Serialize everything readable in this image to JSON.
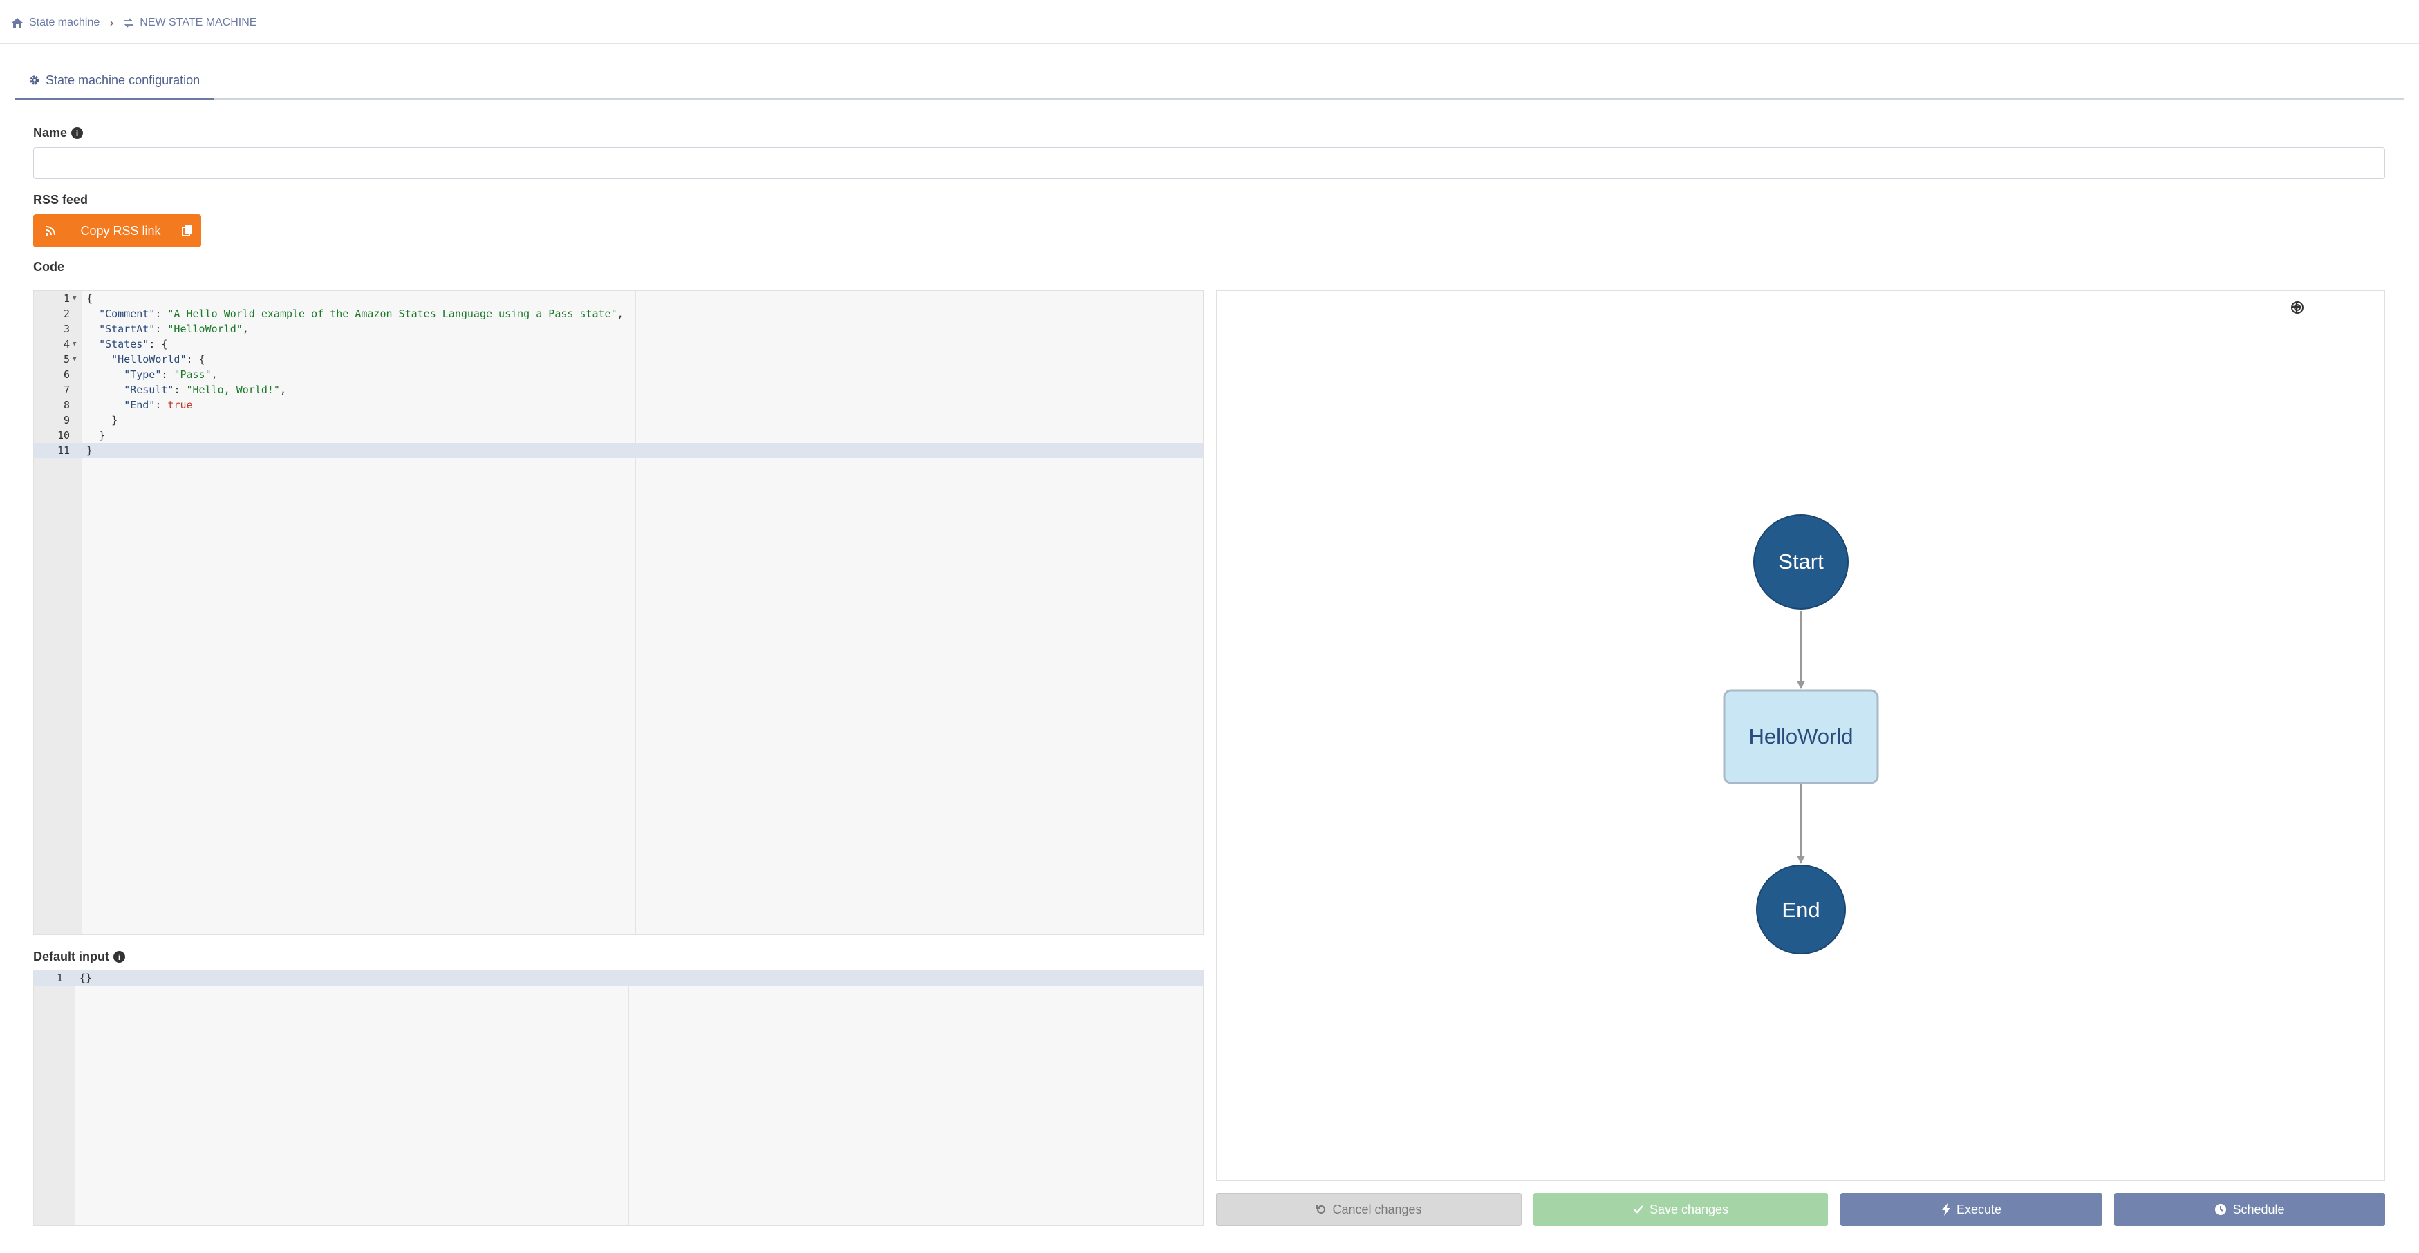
{
  "breadcrumb": {
    "home_label": "State machine",
    "current_label": "NEW STATE MACHINE"
  },
  "tab": {
    "label": "State machine configuration"
  },
  "form": {
    "name_label": "Name",
    "name_value": "",
    "rss_label": "RSS feed",
    "rss_button": "Copy RSS link",
    "code_label": "Code",
    "default_input_label": "Default input"
  },
  "code_lines": [
    {
      "n": "1",
      "fold": true
    },
    {
      "n": "2",
      "fold": false
    },
    {
      "n": "3",
      "fold": false
    },
    {
      "n": "4",
      "fold": true
    },
    {
      "n": "5",
      "fold": true
    },
    {
      "n": "6",
      "fold": false
    },
    {
      "n": "7",
      "fold": false
    },
    {
      "n": "8",
      "fold": false
    },
    {
      "n": "9",
      "fold": false
    },
    {
      "n": "10",
      "fold": false
    },
    {
      "n": "11",
      "fold": false
    }
  ],
  "code": {
    "l1": "{",
    "l2_key": "\"Comment\"",
    "l2_val": "\"A Hello World example of the Amazon States Language using a Pass state\"",
    "l3_key": "\"StartAt\"",
    "l3_val": "\"HelloWorld\"",
    "l4_key": "\"States\"",
    "l4_rest": ": {",
    "l5_key": "\"HelloWorld\"",
    "l5_rest": ": {",
    "l6_key": "\"Type\"",
    "l6_val": "\"Pass\"",
    "l7_key": "\"Result\"",
    "l7_val": "\"Hello, World!\"",
    "l8_key": "\"End\"",
    "l8_val": "true",
    "l9": "}",
    "l10": "}",
    "l11": "}"
  },
  "default_input": {
    "line_number": "1",
    "value": "{}"
  },
  "graph": {
    "start_label": "Start",
    "state_label": "HelloWorld",
    "end_label": "End",
    "colors": {
      "terminal": "#235a8c",
      "state_fill": "#c8e6f3",
      "state_border": "#a9b8c7",
      "edge": "#999999"
    }
  },
  "buttons": {
    "cancel": "Cancel changes",
    "save": "Save changes",
    "execute": "Execute",
    "schedule": "Schedule"
  }
}
